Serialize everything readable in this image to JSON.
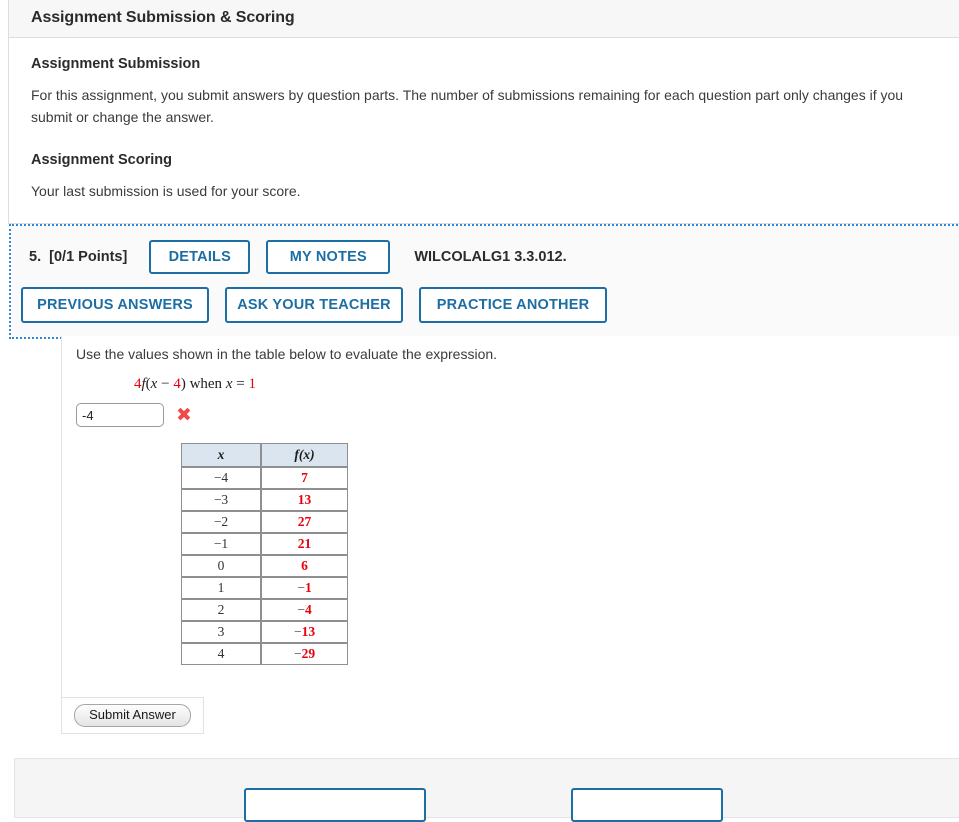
{
  "info_panel": {
    "title": "Assignment Submission & Scoring",
    "submission_heading": "Assignment Submission",
    "submission_text": "For this assignment, you submit answers by question parts. The number of submissions remaining for each question part only changes if you submit or change the answer.",
    "scoring_heading": "Assignment Scoring",
    "scoring_text": "Your last submission is used for your score."
  },
  "question": {
    "number": "5.",
    "points": "[0/1 Points]",
    "details_label": "DETAILS",
    "my_notes_label": "MY NOTES",
    "code": "WILCOLALG1 3.3.012.",
    "previous_answers_label": "PREVIOUS ANSWERS",
    "ask_your_teacher_label": "ASK YOUR TEACHER",
    "practice_another_label": "PRACTICE ANOTHER",
    "prompt": "Use the values shown in the table below to evaluate the expression.",
    "expression": {
      "coefficient": "4",
      "function_name": "f",
      "open_paren": "(",
      "variable": "x",
      "minus": "−",
      "inner_value": "4",
      "close_paren": ")",
      "when_text": "when",
      "when_variable": "x",
      "equals": "=",
      "when_value": "1"
    },
    "answer_value": "-4",
    "answer_placeholder": "",
    "answer_status_icon": "wrong-x-icon",
    "submit_label": "Submit Answer"
  },
  "values_table": {
    "headers": [
      "x",
      "f(x)"
    ],
    "rows": [
      {
        "x": "−4",
        "fx": "7",
        "fx_sign": "",
        "fx_digits": "7"
      },
      {
        "x": "−3",
        "fx": "13",
        "fx_sign": "",
        "fx_digits": "13"
      },
      {
        "x": "−2",
        "fx": "27",
        "fx_sign": "",
        "fx_digits": "27"
      },
      {
        "x": "−1",
        "fx": "21",
        "fx_sign": "",
        "fx_digits": "21"
      },
      {
        "x": "0",
        "fx": "6",
        "fx_sign": "",
        "fx_digits": "6"
      },
      {
        "x": "1",
        "fx": "−1",
        "fx_sign": "−",
        "fx_digits": "1"
      },
      {
        "x": "2",
        "fx": "−4",
        "fx_sign": "−",
        "fx_digits": "4"
      },
      {
        "x": "3",
        "fx": "−13",
        "fx_sign": "−",
        "fx_digits": "13"
      },
      {
        "x": "4",
        "fx": "−29",
        "fx_sign": "−",
        "fx_digits": "29"
      }
    ]
  },
  "colors": {
    "accent_blue": "#1c6ea4",
    "highlight_dotted_blue": "#2f86d6",
    "value_red": "#e8000d",
    "wrong_mark_red": "#f04a4a",
    "table_header_blue": "#dbe5ef"
  }
}
